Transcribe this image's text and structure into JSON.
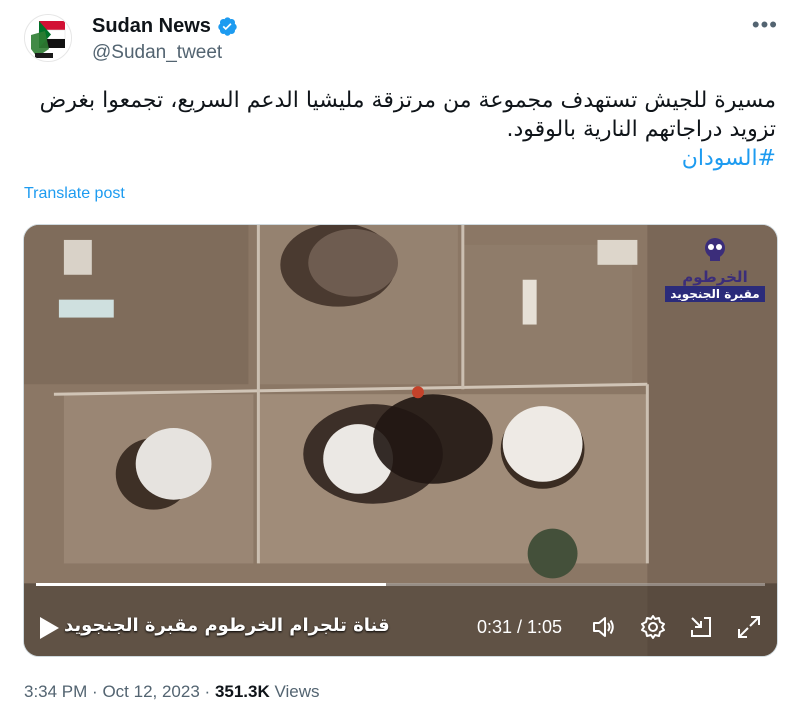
{
  "author": {
    "display_name": "Sudan News",
    "handle": "@Sudan_tweet",
    "avatar_icon": "sudan-flag-logo",
    "verified_color": "#1d9bf0"
  },
  "more_icon": "more-icon",
  "tweet": {
    "text": "مسيرة للجيش تستهدف مجموعة من مرتزقة مليشيا الدعم السريع، تجمعوا بغرض تزويد دراجاتهم النارية بالوقود.",
    "hashtag": "#السودان",
    "translate_label": "Translate post"
  },
  "video": {
    "watermark_line1": "الخرطوم",
    "watermark_line2": "مقبرة الجنجويد",
    "channel_caption": "قناة تلجرام الخرطوم مقبرة الجنجويد",
    "time": "0:31 / 1:05",
    "progress_fraction": 0.48
  },
  "meta": {
    "time": "3:34 PM",
    "date": "Oct 12, 2023",
    "views_count": "351.3K",
    "views_label": "Views",
    "separator": "·"
  }
}
